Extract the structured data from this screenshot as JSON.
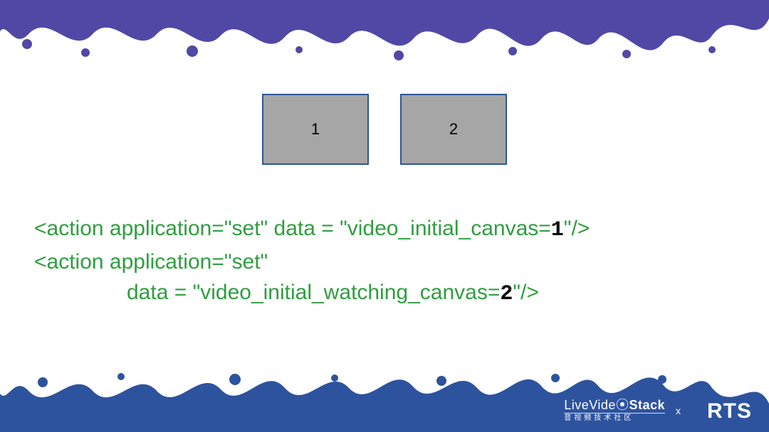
{
  "boxes": {
    "left_label": "1",
    "right_label": "2"
  },
  "code": {
    "line1_head": "<action application=\"set\" data = \"video_initial_canvas=",
    "line1_num": "1",
    "line1_tail": "\"/>",
    "line2_head": "<action application=\"set\"",
    "line3_head": "data = \"video_initial_watching_canvas=",
    "line3_num": "2",
    "line3_tail": "\"/>"
  },
  "footer": {
    "livevideo_prefix": "LiveVide",
    "livevideo_o": "⦿",
    "livevideo_suffix": "Stack",
    "livevideo_sub": "音视频技术社区",
    "x_label": "x",
    "rts_label": "RTS"
  },
  "colors": {
    "purple": "#4b3fa3",
    "blue": "#2d539e",
    "tile_border": "#2f5597",
    "tile_bg": "#a6a6a6",
    "code_green": "#2e9e3f"
  }
}
